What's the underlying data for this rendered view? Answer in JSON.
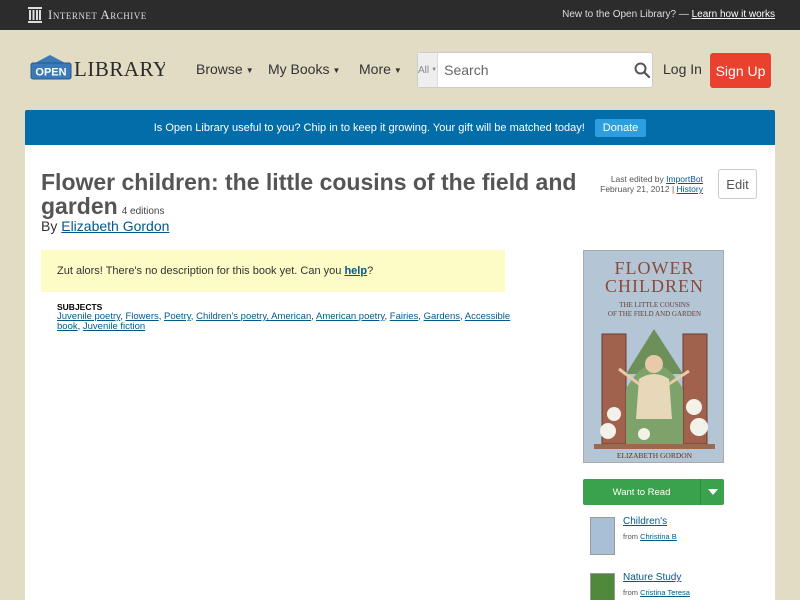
{
  "topbar": {
    "brand": "Internet Archive",
    "new_text": "New to the Open Library? —",
    "learn_link": "Learn how it works"
  },
  "header": {
    "logo_open": "OPEN",
    "logo_library": "LIBRARY",
    "nav": [
      "Browse",
      "My Books",
      "More"
    ],
    "search_scope": "All",
    "search_placeholder": "Search",
    "login": "Log In",
    "signup": "Sign Up"
  },
  "donate": {
    "message": "Is Open Library useful to you? Chip in to keep it growing. Your gift will be matched today!",
    "button": "Donate"
  },
  "book": {
    "title": "Flower children: the little cousins of the field and garden",
    "editions": "4 editions",
    "by": "By",
    "author": "Elizabeth Gordon",
    "last_edited_label": "Last edited by",
    "last_edited_user": "ImportBot",
    "last_edited_date": "February 21, 2012",
    "history": "History",
    "edit": "Edit",
    "desc_text": "Zut alors! There's no description for this book yet. Can you",
    "desc_link": "help",
    "desc_end": "?",
    "subjects_heading": "SUBJECTS",
    "subjects": [
      "Juvenile poetry",
      "Flowers",
      "Poetry",
      "Children's poetry, American",
      "American poetry",
      "Fairies",
      "Gardens",
      "Accessible book",
      "Juvenile fiction"
    ]
  },
  "cover": {
    "title_line1": "FLOWER",
    "title_line2": "CHILDREN",
    "subtitle_line1": "THE LITTLE COUSINS",
    "subtitle_line2": "OF THE FIELD AND GARDEN",
    "author": "ELIZABETH GORDON"
  },
  "reading": {
    "want_to_read": "Want to Read"
  },
  "lists": [
    {
      "name": "Children's",
      "from_label": "from",
      "from_user": "Christina B"
    },
    {
      "name": "Nature Study",
      "from_label": "from",
      "from_user": "Cristina Teresa"
    }
  ],
  "colors": {
    "signup": "#e8412d",
    "donate_bar": "#036daa",
    "want_to_read": "#3aa14c",
    "description_bg": "#fdfbc6",
    "page_bg": "#e2dcc5"
  }
}
